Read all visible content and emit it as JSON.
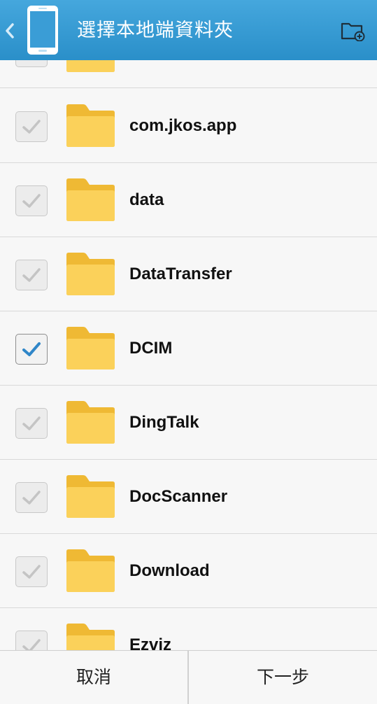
{
  "header": {
    "title": "選擇本地端資料夾",
    "back_icon": "chevron-left-icon",
    "app_icon": "phone-icon",
    "action_icon": "new-folder-icon",
    "color": "#3a9dd6"
  },
  "folders": [
    {
      "name": "",
      "checked": false
    },
    {
      "name": "com.jkos.app",
      "checked": false
    },
    {
      "name": "data",
      "checked": false
    },
    {
      "name": "DataTransfer",
      "checked": false
    },
    {
      "name": "DCIM",
      "checked": true
    },
    {
      "name": "DingTalk",
      "checked": false
    },
    {
      "name": "DocScanner",
      "checked": false
    },
    {
      "name": "Download",
      "checked": false
    },
    {
      "name": "Ezviz",
      "checked": false
    }
  ],
  "footer": {
    "cancel_label": "取消",
    "next_label": "下一步"
  },
  "colors": {
    "folder": "#f8cb45",
    "check_on": "#2f86c8",
    "check_off": "#c4c4c4"
  }
}
